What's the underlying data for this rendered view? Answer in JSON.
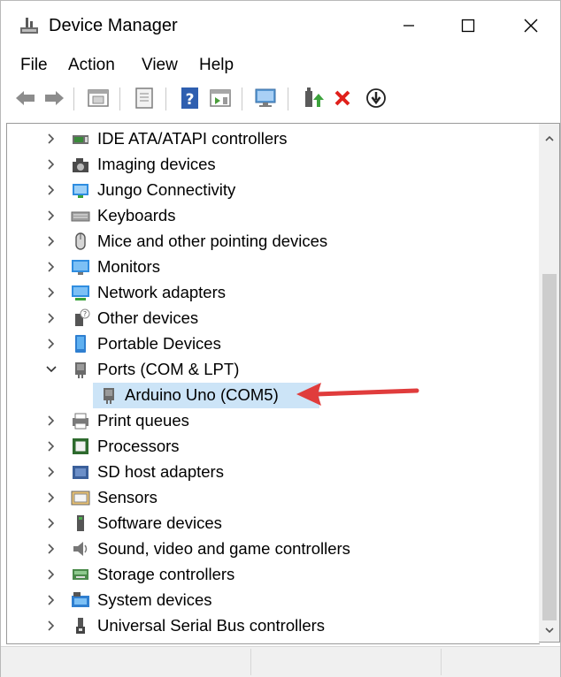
{
  "window": {
    "title": "Device Manager"
  },
  "menu": [
    "File",
    "Action",
    "View",
    "Help"
  ],
  "tree": {
    "items": [
      {
        "label": "IDE ATA/ATAPI controllers",
        "icon": "ide-controller-icon",
        "expanded": false
      },
      {
        "label": "Imaging devices",
        "icon": "imaging-device-icon",
        "expanded": false
      },
      {
        "label": "Jungo Connectivity",
        "icon": "jungo-connectivity-icon",
        "expanded": false
      },
      {
        "label": "Keyboards",
        "icon": "keyboard-icon",
        "expanded": false
      },
      {
        "label": "Mice and other pointing devices",
        "icon": "mouse-icon",
        "expanded": false
      },
      {
        "label": "Monitors",
        "icon": "monitor-icon",
        "expanded": false
      },
      {
        "label": "Network adapters",
        "icon": "network-adapter-icon",
        "expanded": false
      },
      {
        "label": "Other devices",
        "icon": "other-devices-icon",
        "expanded": false
      },
      {
        "label": "Portable Devices",
        "icon": "portable-device-icon",
        "expanded": false
      },
      {
        "label": "Ports (COM & LPT)",
        "icon": "port-icon",
        "expanded": true
      },
      {
        "label": "Arduino Uno (COM5)",
        "icon": "port-icon",
        "child": true,
        "selected": true
      },
      {
        "label": "Print queues",
        "icon": "printer-icon",
        "expanded": false
      },
      {
        "label": "Processors",
        "icon": "processor-icon",
        "expanded": false
      },
      {
        "label": "SD host adapters",
        "icon": "sd-adapter-icon",
        "expanded": false
      },
      {
        "label": "Sensors",
        "icon": "sensor-icon",
        "expanded": false
      },
      {
        "label": "Software devices",
        "icon": "software-device-icon",
        "expanded": false
      },
      {
        "label": "Sound, video and game controllers",
        "icon": "speaker-icon",
        "expanded": false
      },
      {
        "label": "Storage controllers",
        "icon": "storage-controller-icon",
        "expanded": false
      },
      {
        "label": "System devices",
        "icon": "system-device-icon",
        "expanded": false
      },
      {
        "label": "Universal Serial Bus controllers",
        "icon": "usb-icon",
        "expanded": false
      }
    ]
  },
  "colors": {
    "selection": "#cce4f7",
    "annotation_arrow": "#e03c3c",
    "uninstall_x": "#e0201b"
  }
}
